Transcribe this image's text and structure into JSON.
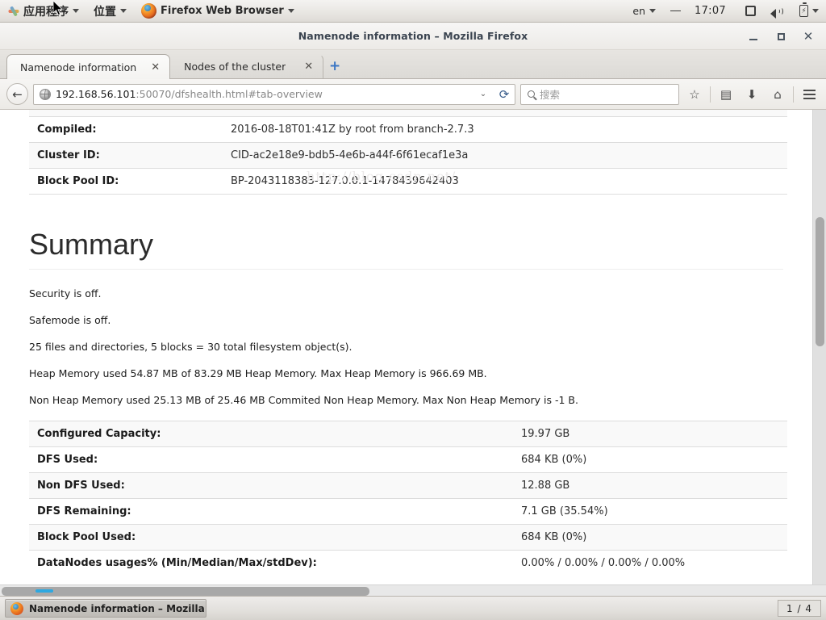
{
  "desktop_panel": {
    "applications_menu": "应用程序",
    "places_menu": "位置",
    "active_app": "Firefox Web Browser",
    "keyboard_layout": "en",
    "clock": "17:07",
    "icons": [
      "display-icon",
      "volume-icon",
      "battery-icon"
    ]
  },
  "window": {
    "title": "Namenode information – Mozilla Firefox",
    "minimize": "_",
    "maximize": "□",
    "close": "✕"
  },
  "tabs": [
    {
      "label": "Namenode information",
      "close": "✕",
      "active": true
    },
    {
      "label": "Nodes of the cluster",
      "close": "✕",
      "active": false
    }
  ],
  "newtab_label": "+",
  "navbar": {
    "back": "←",
    "url_host": "192.168.56.101",
    "url_rest": ":50070/dfshealth.html#tab-overview",
    "url_dropdown": "⌄",
    "reload": "⟳",
    "search_placeholder": "搜索",
    "bookmark": "☆",
    "library": "▤",
    "downloads": "⬇",
    "home": "⌂",
    "menu": "☰"
  },
  "page": {
    "overview_table": [
      {
        "key": "Compiled:",
        "value": "2016-08-18T01:41Z by root from branch-2.7.3"
      },
      {
        "key": "Cluster ID:",
        "value": "CID-ac2e18e9-bdb5-4e6b-a44f-6f61ecaf1e3a"
      },
      {
        "key": "Block Pool ID:",
        "value": "BP-2043118383-127.0.0.1-1478439642403"
      }
    ],
    "summary_heading": "Summary",
    "watermark": "http://blog.csdn.net/",
    "summary_lines": [
      "Security is off.",
      "Safemode is off.",
      "25 files and directories, 5 blocks = 30 total filesystem object(s).",
      "Heap Memory used 54.87 MB of 83.29 MB Heap Memory. Max Heap Memory is 966.69 MB.",
      "Non Heap Memory used 25.13 MB of 25.46 MB Commited Non Heap Memory. Max Non Heap Memory is -1 B."
    ],
    "capacity_table": [
      {
        "key": "Configured Capacity:",
        "value": "19.97 GB"
      },
      {
        "key": "DFS Used:",
        "value": "684 KB (0%)"
      },
      {
        "key": "Non DFS Used:",
        "value": "12.88 GB"
      },
      {
        "key": "DFS Remaining:",
        "value": "7.1 GB (35.54%)"
      },
      {
        "key": "Block Pool Used:",
        "value": "684 KB (0%)"
      },
      {
        "key": "DataNodes usages% (Min/Median/Max/stdDev):",
        "value": "0.00% / 0.00% / 0.00% / 0.00%"
      }
    ]
  },
  "taskbar": {
    "window_button": "Namenode information – Mozilla …",
    "workspace": "1 / 4"
  }
}
